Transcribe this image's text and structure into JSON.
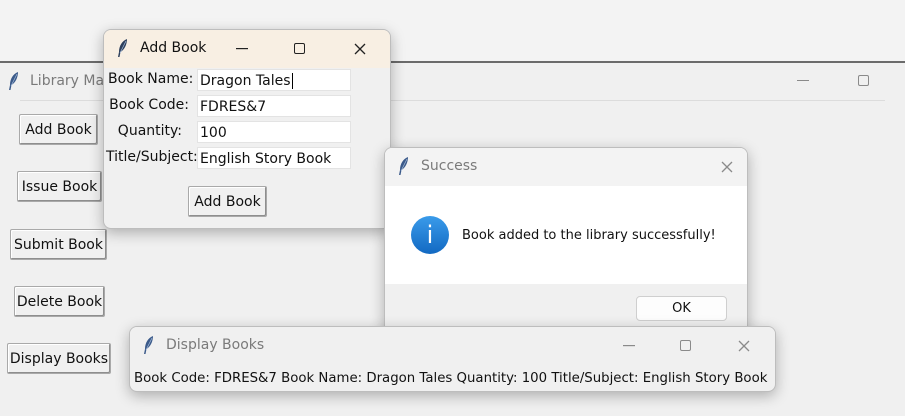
{
  "main_window": {
    "title": "Library Ma",
    "buttons": {
      "add_book": "Add Book",
      "issue_book": "Issue Book",
      "submit_book": "Submit Book",
      "delete_book": "Delete Book",
      "display_books": "Display Books"
    }
  },
  "add_book_dialog": {
    "title": "Add Book",
    "fields": {
      "book_name_label": "Book Name:",
      "book_name_value": "Dragon Tales",
      "book_code_label": "Book Code:",
      "book_code_value": "FDRES&7",
      "quantity_label": "Quantity:",
      "quantity_value": "100",
      "title_subject_label": "Title/Subject:",
      "title_subject_value": "English  Story Book"
    },
    "submit_label": "Add Book"
  },
  "success_dialog": {
    "title": "Success",
    "message": "Book added to the library successfully!",
    "ok_label": "OK",
    "info_glyph": "i"
  },
  "display_window": {
    "title": "Display Books",
    "content": "Book Code: FDRES&7  Book Name: Dragon Tales  Quantity: 100  Title/Subject: English  Story Book"
  },
  "icons": {
    "window_icon": "feather-icon",
    "info_icon_color": "#1a7fd4"
  }
}
